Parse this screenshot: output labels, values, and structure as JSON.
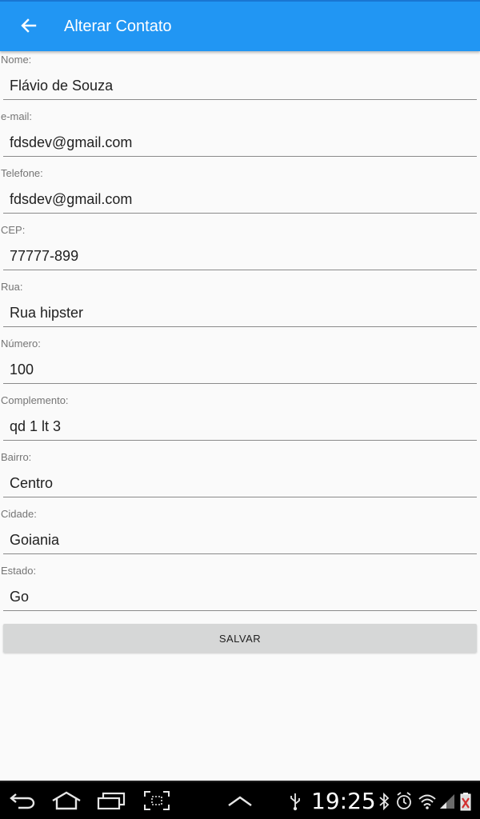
{
  "app_bar": {
    "title": "Alterar Contato",
    "back_icon": "arrow-back-icon",
    "color": "#2196f3"
  },
  "form": {
    "fields": [
      {
        "label": "Nome:",
        "value": "Flávio de Souza"
      },
      {
        "label": "e-mail:",
        "value": "fdsdev@gmail.com"
      },
      {
        "label": "Telefone:",
        "value": "fdsdev@gmail.com"
      },
      {
        "label": "CEP:",
        "value": "77777-899"
      },
      {
        "label": "Rua:",
        "value": "Rua hipster"
      },
      {
        "label": "Número:",
        "value": "100"
      },
      {
        "label": "Complemento:",
        "value": "qd 1 lt 3"
      },
      {
        "label": "Bairro:",
        "value": "Centro"
      },
      {
        "label": "Cidade:",
        "value": "Goiania"
      },
      {
        "label": "Estado:",
        "value": "Go"
      }
    ],
    "save_label": "SALVAR"
  },
  "system_bar": {
    "time": "19:25",
    "nav_icons": [
      "back-icon",
      "home-icon",
      "recent-apps-icon",
      "screenshot-icon",
      "chevron-up-icon"
    ],
    "status_icons": [
      "usb-icon",
      "bluetooth-icon",
      "alarm-icon",
      "wifi-icon",
      "signal-icon",
      "battery-icon"
    ]
  }
}
